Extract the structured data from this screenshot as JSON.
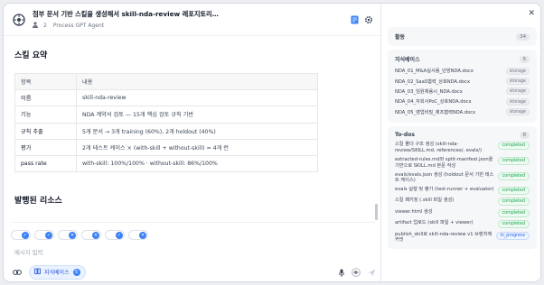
{
  "header": {
    "title": "첨부 문서 기반 스킬을 생성해서 skill-nda-review 레포지토리…",
    "member_count": "2",
    "agent": "Process GPT Agent"
  },
  "content": {
    "summary_heading": "스킬 요약",
    "table": {
      "headers": [
        "항목",
        "내용"
      ],
      "rows": [
        [
          "이름",
          "skill-nda-review"
        ],
        [
          "기능",
          "NDA 계약서 검토 — 15개 핵심 검토 규칙 기반"
        ],
        [
          "규칙 추출",
          "5개 문서 → 3개 training (60%), 2개 holdout (40%)"
        ],
        [
          "평가",
          "2개 테스트 케이스 × (with-skill + without-skill) = 4개 런"
        ],
        [
          "pass rate",
          "with-skill: 100%/100% · without-skill: 86%/100%"
        ]
      ]
    },
    "resources_heading": "발행된 리소스"
  },
  "composer": {
    "placeholder": "메시지 입력",
    "kb_label": "지식베이스",
    "kb_count": "5"
  },
  "sidebar": {
    "activity": {
      "title": "활동",
      "count": "34"
    },
    "knowledge": {
      "title": "지식베이스",
      "count": "5",
      "items": [
        {
          "name": "NDA_01_M&A실사용_단방NDA.docx",
          "tag": "storage"
        },
        {
          "name": "NDA_02_SaaS협력_상호NDA.docx",
          "tag": "storage"
        },
        {
          "name": "NDA_03_임원채용시_NDA.docx",
          "tag": "storage"
        },
        {
          "name": "NDA_04_자회사PoC_상호NDA.docx",
          "tag": "storage"
        },
        {
          "name": "NDA_05_영업비밀_제조협력NDA.docx",
          "tag": "storage"
        }
      ]
    },
    "todos": {
      "title": "To-dos",
      "count": "8",
      "items": [
        {
          "text": "스킬 폴더 구조 생성 (skill-nda-review/SKILL.md, references/, evals/)",
          "status": "completed"
        },
        {
          "text": "extracted-rules.md와 split-manifest.json을 기반으로 SKILL.md 본문 작성",
          "status": "completed"
        },
        {
          "text": "evals/evals.json 생성 (holdout 문서 기반 테스트 케이스)",
          "status": "completed"
        },
        {
          "text": "evals 실행 및 평가 (test-runner + evaluator)",
          "status": "completed"
        },
        {
          "text": "스킬 패키징 (.skill 파일 생성)",
          "status": "completed"
        },
        {
          "text": "viewer.html 생성",
          "status": "completed"
        },
        {
          "text": "artifact 업로드 (skill 파일 + viewer)",
          "status": "completed"
        },
        {
          "text": "publish_skill로 skill-nda-review v1 브랜치에 커밋",
          "status": "in_progress"
        }
      ]
    }
  }
}
